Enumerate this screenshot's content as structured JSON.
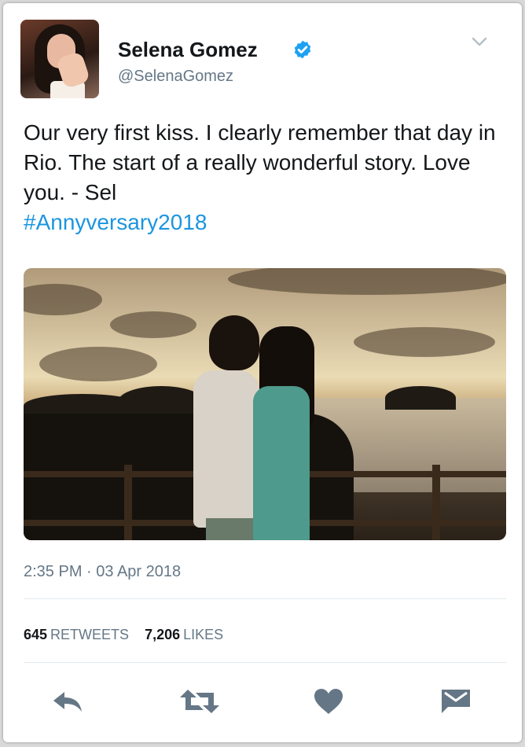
{
  "user": {
    "name": "Selena Gomez",
    "handle": "@SelenaGomez",
    "avatar_icon": "profile-photo"
  },
  "tweet": {
    "text": "Our very first kiss. I clearly remember that day in Rio. The start of a really wonderful story. Love you. - Sel",
    "hashtag": "#Annyversary2018",
    "timestamp": "2:35 PM · 03 Apr 2018"
  },
  "stats": {
    "retweets_count": "645",
    "retweets_label": "RETWEETS",
    "likes_count": "7,206",
    "likes_label": "LIKES"
  },
  "actions": [
    {
      "icon": "reply-icon"
    },
    {
      "icon": "retweet-icon"
    },
    {
      "icon": "heart-icon"
    },
    {
      "icon": "direct-message-icon"
    }
  ],
  "colors": {
    "accent": "#1b95e0",
    "verified": "#1da1f2",
    "secondary_text": "#657786",
    "icon": "#657786"
  }
}
